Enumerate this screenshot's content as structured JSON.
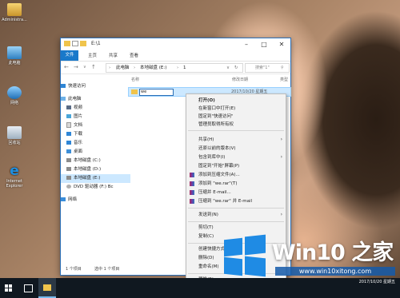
{
  "desktop": {
    "icons": [
      {
        "label": "Administra...",
        "icon": "user-folder-icon"
      },
      {
        "label": "此电脑",
        "icon": "computer-icon"
      },
      {
        "label": "网络",
        "icon": "network-icon"
      },
      {
        "label": "回收站",
        "icon": "recycle-bin-icon"
      },
      {
        "label": "Internet Explorer",
        "icon": "ie-icon"
      }
    ]
  },
  "explorer": {
    "title": "E:\\1",
    "ribbon_tabs": [
      "文件",
      "主页",
      "共享",
      "查看"
    ],
    "breadcrumb": [
      "此电脑",
      "本地磁盘 (E:)",
      "1"
    ],
    "search_placeholder": "搜索\"1\"",
    "columns": [
      "名称",
      "修改日期",
      "类型",
      "大小"
    ],
    "nav_items": [
      {
        "label": "快速访问"
      },
      {
        "label": "此电脑"
      },
      {
        "label": "视频"
      },
      {
        "label": "图片"
      },
      {
        "label": "文档"
      },
      {
        "label": "下载"
      },
      {
        "label": "音乐"
      },
      {
        "label": "桌面"
      },
      {
        "label": "本地磁盘 (C:)"
      },
      {
        "label": "本地磁盘 (D:)"
      },
      {
        "label": "本地磁盘 (E:)"
      },
      {
        "label": "DVD 驱动器 (F:) Bc"
      },
      {
        "label": "网络"
      }
    ],
    "file": {
      "name": "we",
      "date": "2017/10/20 星期五"
    },
    "status": {
      "count": "1 个项目",
      "selected": "选中 1 个项目"
    }
  },
  "context_menu": {
    "items": [
      {
        "label": "打开(O)",
        "bold": true
      },
      {
        "label": "在新窗口中打开(E)"
      },
      {
        "label": "固定到\"快速访问\""
      },
      {
        "label": "管理员取得所有权"
      },
      {
        "label": "共享(H)",
        "submenu": true
      },
      {
        "label": "还原以前的版本(V)"
      },
      {
        "label": "包含到库中(I)",
        "submenu": true
      },
      {
        "label": "固定到\"开始\"屏幕(P)"
      },
      {
        "label": "添加到压缩文件(A)...",
        "rar": true
      },
      {
        "label": "添加到 \"we.rar\"(T)",
        "rar": true
      },
      {
        "label": "压缩并 E-mail...",
        "rar": true
      },
      {
        "label": "压缩到 \"we.rar\" 并 E-mail",
        "rar": true
      },
      {
        "label": "发送到(N)",
        "submenu": true
      },
      {
        "label": "剪切(T)"
      },
      {
        "label": "复制(C)"
      },
      {
        "label": "创建快捷方式(S)"
      },
      {
        "label": "删除(D)"
      },
      {
        "label": "重命名(M)"
      },
      {
        "label": "属性(R)"
      }
    ]
  },
  "taskbar": {
    "clock": "2017/10/20 星期五"
  },
  "watermark": {
    "title": "Win10 之家",
    "url": "www.win10xitong.com"
  },
  "colors": {
    "accent": "#1979ca",
    "selection": "#cce8ff",
    "watermark_blue": "#1f8be4"
  }
}
